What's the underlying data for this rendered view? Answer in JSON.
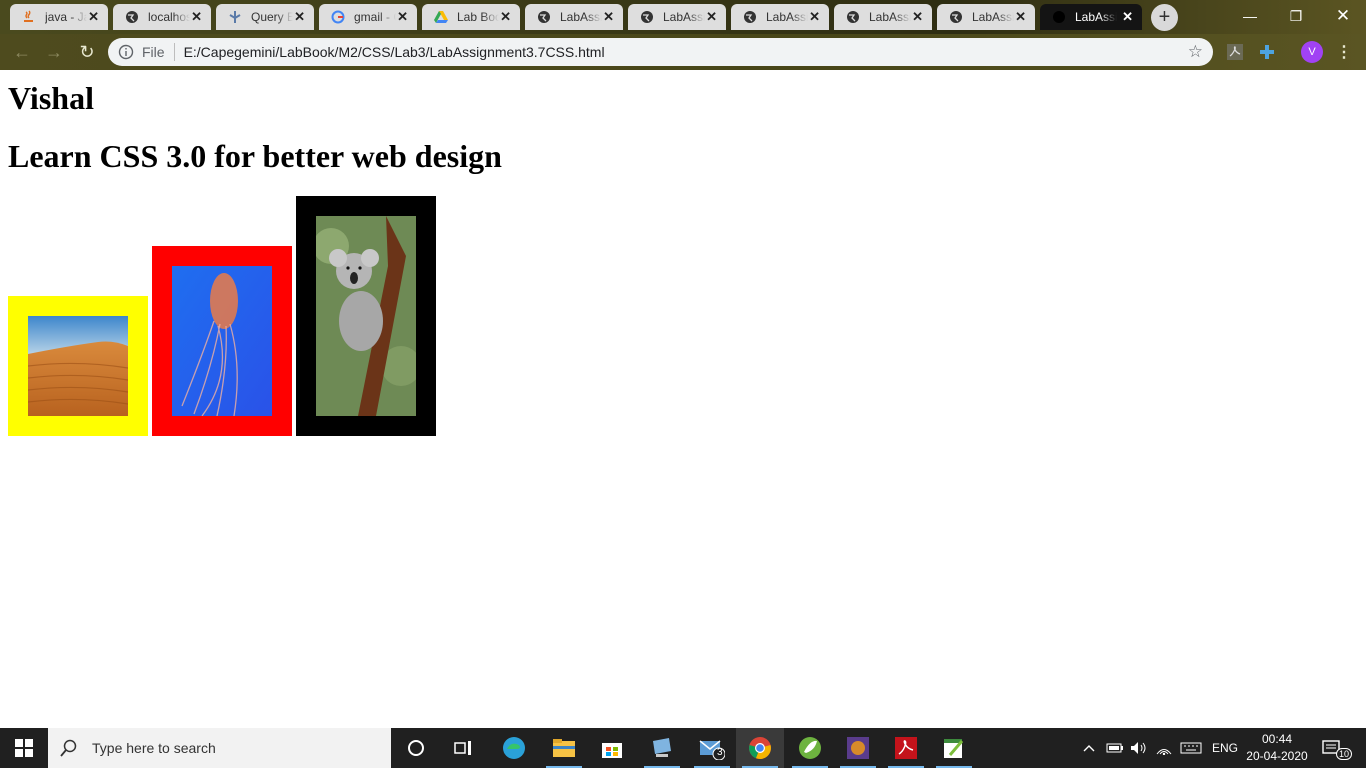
{
  "browser": {
    "tabs": [
      {
        "title": "java - Javatpoint",
        "icon": "java-icon"
      },
      {
        "title": "localhost",
        "icon": "globe-icon"
      },
      {
        "title": "Query Editor",
        "icon": "query-icon"
      },
      {
        "title": "gmail - Google",
        "icon": "google-icon"
      },
      {
        "title": "Lab Book",
        "icon": "drive-icon"
      },
      {
        "title": "LabAssignment",
        "icon": "globe-icon"
      },
      {
        "title": "LabAssignment",
        "icon": "globe-icon"
      },
      {
        "title": "LabAssignment",
        "icon": "globe-icon"
      },
      {
        "title": "LabAssignment",
        "icon": "globe-icon"
      },
      {
        "title": "LabAssignment",
        "icon": "globe-icon"
      },
      {
        "title": "LabAssignment",
        "icon": "globe-icon"
      }
    ],
    "address": {
      "scheme_label": "File",
      "url": "E:/Capegemini/LabBook/M2/CSS/Lab3/LabAssignment3.7CSS.html"
    },
    "profile_initial": "V"
  },
  "page": {
    "heading": "Vishal",
    "subheading": "Learn CSS 3.0 for better web design",
    "images": [
      {
        "name": "desert-image",
        "border_color": "#ffff00"
      },
      {
        "name": "jellyfish-image",
        "border_color": "#ff0000"
      },
      {
        "name": "koala-image",
        "border_color": "#000000"
      }
    ]
  },
  "taskbar": {
    "search_placeholder": "Type here to search",
    "mail_badge": "3",
    "language": "ENG",
    "time": "00:44",
    "date": "20-04-2020",
    "notification_count": "10"
  }
}
